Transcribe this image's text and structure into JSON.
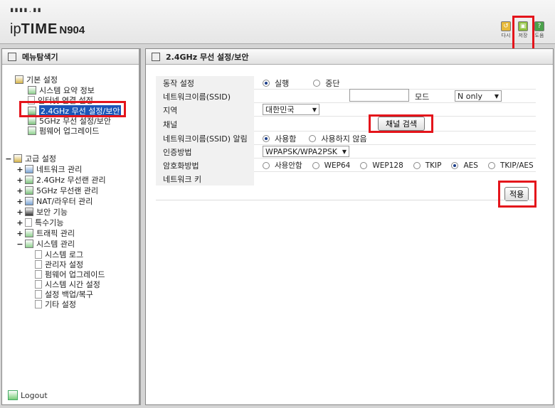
{
  "header": {
    "logo_dots": "∎∎∎∎.∎∎",
    "logo_prefix": "ip",
    "logo_brand": "TIME",
    "model": "N904",
    "buttons": [
      {
        "label": "다시",
        "icon": "refresh-icon",
        "color": "#e7b93a"
      },
      {
        "label": "저장",
        "icon": "save-icon",
        "color": "#8fc13e"
      },
      {
        "label": "도움",
        "icon": "help-icon",
        "color": "#4aa24a",
        "glyph": "?"
      }
    ]
  },
  "sidebar": {
    "title": "메뉴탐색기",
    "basic": {
      "label": "기본 설정",
      "items": [
        "시스템 요약 정보",
        "인터넷 연결 설정",
        "2.4GHz 무선 설정/보안",
        "5GHz 무선 설정/보안",
        "펌웨어 업그레이드"
      ]
    },
    "advanced": {
      "label": "고급 설정",
      "items": [
        "네트워크 관리",
        "2.4GHz 무선랜 관리",
        "5GHz 무선랜 관리",
        "NAT/라우터 관리",
        "보안 기능",
        "특수기능",
        "트래픽 관리",
        "시스템 관리"
      ],
      "system_items": [
        "시스템 로그",
        "관리자 설정",
        "펌웨어 업그레이드",
        "시스템 시간 설정",
        "설정 백업/복구",
        "기타 설정"
      ]
    },
    "logout": "Logout"
  },
  "main": {
    "title": "2.4GHz 무선 설정/보안",
    "rows": {
      "operation": {
        "label": "동작 설정",
        "options": [
          "실행",
          "중단"
        ],
        "selected": 0
      },
      "ssid": {
        "label": "네트워크이름(SSID)",
        "value": ""
      },
      "mode": {
        "label": "모드",
        "value": "N only"
      },
      "region": {
        "label": "지역",
        "value": "대한민국"
      },
      "channel": {
        "label": "채널",
        "button": "채널 검색"
      },
      "ssid_broadcast": {
        "label": "네트워크이름(SSID) 알림",
        "options": [
          "사용함",
          "사용하지 않음"
        ],
        "selected": 0
      },
      "auth": {
        "label": "인증방법",
        "value": "WPAPSK/WPA2PSK"
      },
      "encryption": {
        "label": "암호화방법",
        "options": [
          "사용안함",
          "WEP64",
          "WEP128",
          "TKIP",
          "AES",
          "TKIP/AES"
        ],
        "selected": 4
      },
      "key": {
        "label": "네트워크 키"
      }
    },
    "apply": "적용"
  }
}
